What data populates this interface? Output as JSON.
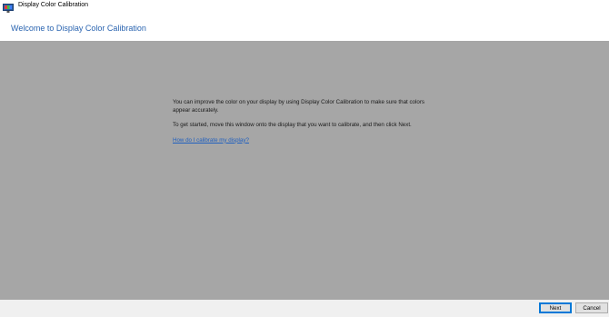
{
  "window": {
    "title": "Display Color Calibration",
    "icon": "display-calibration-icon"
  },
  "header": {
    "title": "Welcome to Display Color Calibration"
  },
  "content": {
    "paragraph1": "You can improve the color on your display by using Display Color Calibration to make sure that colors appear accurately.",
    "paragraph2": "To get started, move this window onto the display that you want to calibrate, and then click Next.",
    "help_link": "How do I calibrate my display?"
  },
  "footer": {
    "next_label": "Next",
    "cancel_label": "Cancel"
  },
  "colors": {
    "content_bg": "#a6a6a6",
    "header_title": "#2a64b0",
    "link": "#1f5fbf",
    "default_button_border": "#0078d7"
  }
}
